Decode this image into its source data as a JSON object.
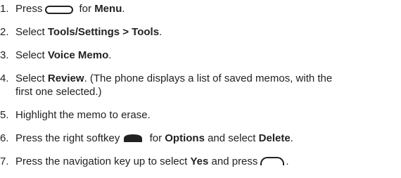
{
  "steps": [
    {
      "num": "1.",
      "before": "Press",
      "key": "menu-key",
      "after": " for ",
      "bold": "Menu",
      "end": "."
    },
    {
      "num": "2.",
      "before": "Select ",
      "bold": "Tools/Settings > Tools",
      "end": "."
    },
    {
      "num": "3.",
      "before": "Select ",
      "bold": "Voice Memo",
      "end": "."
    },
    {
      "num": "4.",
      "before": "Select ",
      "bold": "Review",
      "after": ". (The phone displays a list of saved memos, with the",
      "line2": "first one selected.)"
    },
    {
      "num": "5.",
      "before": "Highlight the memo to erase."
    },
    {
      "num": "6.",
      "before": "Press the right softkey",
      "key": "right-softkey",
      "after": " for ",
      "bold": "Options",
      "mid": " and select ",
      "bold2": "Delete",
      "end": "."
    },
    {
      "num": "7.",
      "before": "Press the navigation key up to select ",
      "bold": "Yes",
      "after": " and press",
      "key": "ok-key",
      "end": "."
    }
  ]
}
